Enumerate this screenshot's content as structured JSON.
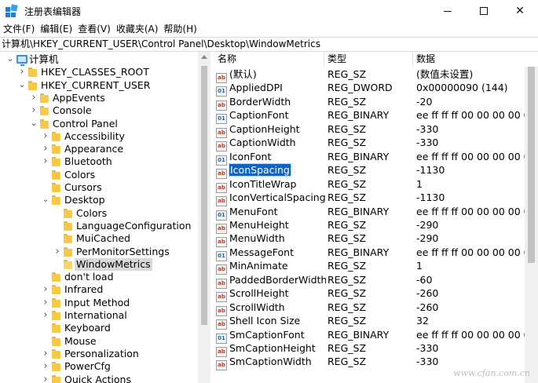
{
  "window": {
    "title": "注册表编辑器",
    "controls": {
      "minimize": "—",
      "maximize": "☐",
      "close": "✕"
    }
  },
  "menu": [
    "文件(F)",
    "编辑(E)",
    "查看(V)",
    "收藏夹(A)",
    "帮助(H)"
  ],
  "address": "计算机\\HKEY_CURRENT_USER\\Control Panel\\Desktop\\WindowMetrics",
  "tree": [
    {
      "label": "计算机",
      "depth": 0,
      "expander": "down",
      "icon": "computer"
    },
    {
      "label": "HKEY_CLASSES_ROOT",
      "depth": 1,
      "expander": "right",
      "icon": "folder"
    },
    {
      "label": "HKEY_CURRENT_USER",
      "depth": 1,
      "expander": "down",
      "icon": "folder"
    },
    {
      "label": "AppEvents",
      "depth": 2,
      "expander": "right",
      "icon": "folder"
    },
    {
      "label": "Console",
      "depth": 2,
      "expander": "right",
      "icon": "folder"
    },
    {
      "label": "Control Panel",
      "depth": 2,
      "expander": "down",
      "icon": "folder"
    },
    {
      "label": "Accessibility",
      "depth": 3,
      "expander": "right",
      "icon": "folder"
    },
    {
      "label": "Appearance",
      "depth": 3,
      "expander": "right",
      "icon": "folder"
    },
    {
      "label": "Bluetooth",
      "depth": 3,
      "expander": "right",
      "icon": "folder"
    },
    {
      "label": "Colors",
      "depth": 3,
      "expander": "none",
      "icon": "folder"
    },
    {
      "label": "Cursors",
      "depth": 3,
      "expander": "none",
      "icon": "folder"
    },
    {
      "label": "Desktop",
      "depth": 3,
      "expander": "down",
      "icon": "folder"
    },
    {
      "label": "Colors",
      "depth": 4,
      "expander": "none",
      "icon": "folder"
    },
    {
      "label": "LanguageConfiguration",
      "depth": 4,
      "expander": "none",
      "icon": "folder"
    },
    {
      "label": "MuiCached",
      "depth": 4,
      "expander": "none",
      "icon": "folder"
    },
    {
      "label": "PerMonitorSettings",
      "depth": 4,
      "expander": "right",
      "icon": "folder"
    },
    {
      "label": "WindowMetrics",
      "depth": 4,
      "expander": "none",
      "icon": "folder-open",
      "selected": true
    },
    {
      "label": "don't load",
      "depth": 3,
      "expander": "none",
      "icon": "folder"
    },
    {
      "label": "Infrared",
      "depth": 3,
      "expander": "right",
      "icon": "folder"
    },
    {
      "label": "Input Method",
      "depth": 3,
      "expander": "right",
      "icon": "folder"
    },
    {
      "label": "International",
      "depth": 3,
      "expander": "right",
      "icon": "folder"
    },
    {
      "label": "Keyboard",
      "depth": 3,
      "expander": "none",
      "icon": "folder"
    },
    {
      "label": "Mouse",
      "depth": 3,
      "expander": "none",
      "icon": "folder"
    },
    {
      "label": "Personalization",
      "depth": 3,
      "expander": "right",
      "icon": "folder"
    },
    {
      "label": "PowerCfg",
      "depth": 3,
      "expander": "right",
      "icon": "folder"
    },
    {
      "label": "Quick Actions",
      "depth": 3,
      "expander": "right",
      "icon": "folder"
    }
  ],
  "columns": {
    "name": "名称",
    "type": "类型",
    "data": "数据"
  },
  "values": [
    {
      "name": "(默认)",
      "type": "REG_SZ",
      "data": "(数值未设置)",
      "icon": "string"
    },
    {
      "name": "AppliedDPI",
      "type": "REG_DWORD",
      "data": "0x00000090 (144)",
      "icon": "binary"
    },
    {
      "name": "BorderWidth",
      "type": "REG_SZ",
      "data": "-20",
      "icon": "string"
    },
    {
      "name": "CaptionFont",
      "type": "REG_BINARY",
      "data": "ee ff ff ff 00 00 00 00 00 0",
      "icon": "binary"
    },
    {
      "name": "CaptionHeight",
      "type": "REG_SZ",
      "data": "-330",
      "icon": "string"
    },
    {
      "name": "CaptionWidth",
      "type": "REG_SZ",
      "data": "-330",
      "icon": "string"
    },
    {
      "name": "IconFont",
      "type": "REG_BINARY",
      "data": "ee ff ff ff 00 00 00 00 00 0",
      "icon": "binary"
    },
    {
      "name": "IconSpacing",
      "type": "REG_SZ",
      "data": "-1130",
      "icon": "string",
      "selected": true
    },
    {
      "name": "IconTitleWrap",
      "type": "REG_SZ",
      "data": "1",
      "icon": "string"
    },
    {
      "name": "IconVerticalSpacing",
      "type": "REG_SZ",
      "data": "-1130",
      "icon": "string"
    },
    {
      "name": "MenuFont",
      "type": "REG_BINARY",
      "data": "ee ff ff ff 00 00 00 00 00 0",
      "icon": "binary"
    },
    {
      "name": "MenuHeight",
      "type": "REG_SZ",
      "data": "-290",
      "icon": "string"
    },
    {
      "name": "MenuWidth",
      "type": "REG_SZ",
      "data": "-290",
      "icon": "string"
    },
    {
      "name": "MessageFont",
      "type": "REG_BINARY",
      "data": "ee ff ff ff 00 00 00 00 00 0",
      "icon": "binary"
    },
    {
      "name": "MinAnimate",
      "type": "REG_SZ",
      "data": "1",
      "icon": "string"
    },
    {
      "name": "PaddedBorderWidth",
      "type": "REG_SZ",
      "data": "-60",
      "icon": "string"
    },
    {
      "name": "ScrollHeight",
      "type": "REG_SZ",
      "data": "-260",
      "icon": "string"
    },
    {
      "name": "ScrollWidth",
      "type": "REG_SZ",
      "data": "-260",
      "icon": "string"
    },
    {
      "name": "Shell Icon Size",
      "type": "REG_SZ",
      "data": "32",
      "icon": "string"
    },
    {
      "name": "SmCaptionFont",
      "type": "REG_BINARY",
      "data": "ee ff ff ff 00 00 00 00 00 0",
      "icon": "binary"
    },
    {
      "name": "SmCaptionHeight",
      "type": "REG_SZ",
      "data": "-330",
      "icon": "string"
    },
    {
      "name": "SmCaptionWidth",
      "type": "REG_SZ",
      "data": "-330",
      "icon": "string"
    }
  ],
  "value_icon_text": {
    "string": "ab",
    "binary": "01"
  },
  "watermark": "www.cfan.com.cn"
}
